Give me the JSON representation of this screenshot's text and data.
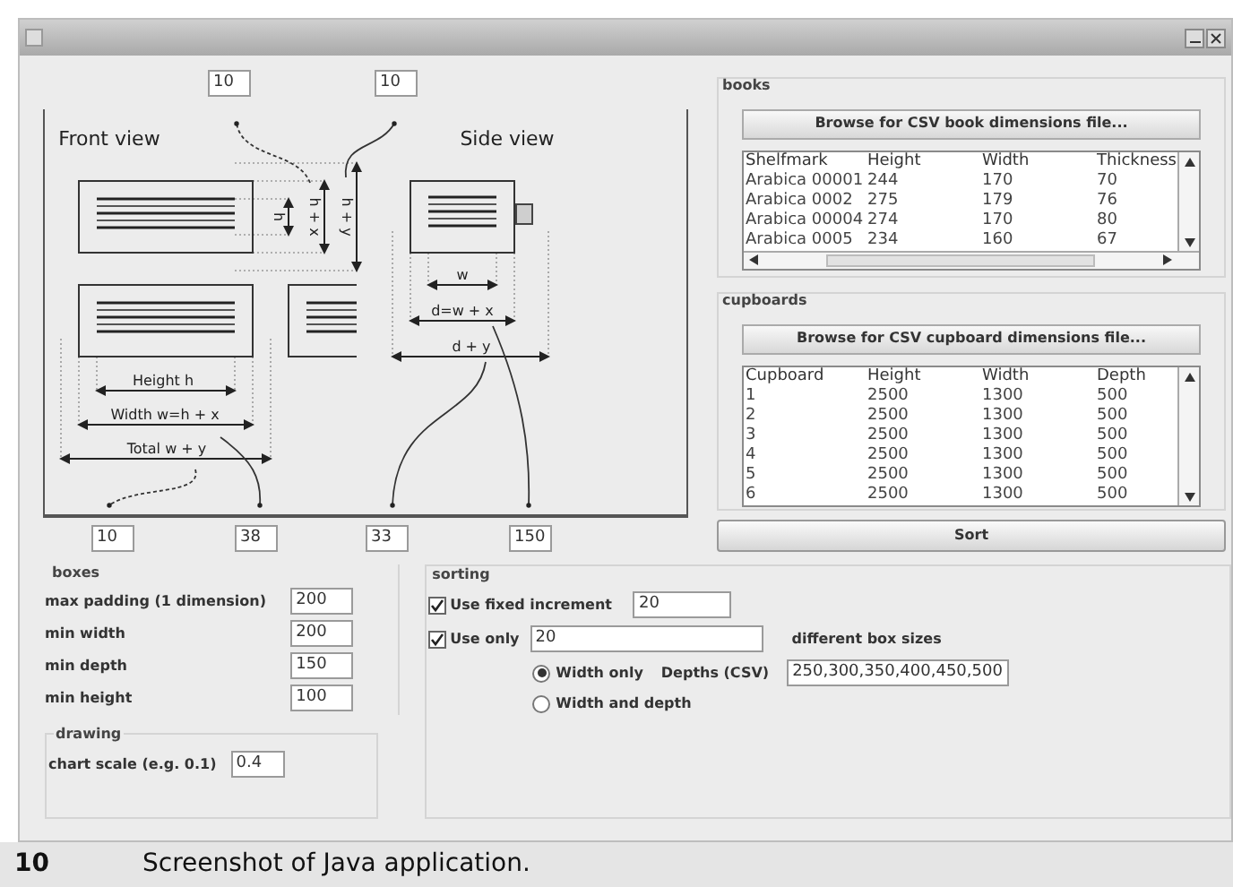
{
  "diagram": {
    "top_fields": [
      "10",
      "10"
    ],
    "labels": {
      "front_view": "Front view",
      "side_view": "Side view",
      "h": "h",
      "h_plus_x": "h + x",
      "h_plus_y": "h + y",
      "height": "Height h",
      "width": "Width w=h + x",
      "total": "Total w + y",
      "w": "w",
      "d": "d=w + x",
      "d_plus_y": "d + y"
    },
    "bottom_fields": [
      "10",
      "38",
      "33",
      "150"
    ]
  },
  "books": {
    "title": "books",
    "browse_button": "Browse for CSV book dimensions file...",
    "columns": [
      "Shelfmark",
      "Height",
      "Width",
      "Thickness"
    ],
    "rows": [
      [
        "Arabica 00001",
        "244",
        "170",
        "70"
      ],
      [
        "Arabica 0002",
        "275",
        "179",
        "76"
      ],
      [
        "Arabica 00004",
        "274",
        "170",
        "80"
      ],
      [
        "Arabica 0005",
        "234",
        "160",
        "67"
      ]
    ]
  },
  "cupboards": {
    "title": "cupboards",
    "browse_button": "Browse for CSV cupboard dimensions file...",
    "columns": [
      "Cupboard",
      "Height",
      "Width",
      "Depth"
    ],
    "rows": [
      [
        "1",
        "2500",
        "1300",
        "500"
      ],
      [
        "2",
        "2500",
        "1300",
        "500"
      ],
      [
        "3",
        "2500",
        "1300",
        "500"
      ],
      [
        "4",
        "2500",
        "1300",
        "500"
      ],
      [
        "5",
        "2500",
        "1300",
        "500"
      ],
      [
        "6",
        "2500",
        "1300",
        "500"
      ]
    ]
  },
  "sort_button": "Sort",
  "boxes": {
    "title": "boxes",
    "fields": [
      {
        "label": "max padding (1 dimension)",
        "value": "200"
      },
      {
        "label": "min width",
        "value": "200"
      },
      {
        "label": "min depth",
        "value": "150"
      },
      {
        "label": "min height",
        "value": "100"
      }
    ]
  },
  "drawing": {
    "title": "drawing",
    "fields": [
      {
        "label": "chart scale (e.g. 0.1)",
        "value": "0.4"
      }
    ]
  },
  "sorting": {
    "title": "sorting",
    "fixed_increment": {
      "label": "Use fixed increment",
      "checked": true,
      "value": "20"
    },
    "use_only": {
      "label": "Use only",
      "checked": true,
      "value": "20",
      "suffix": "different box sizes"
    },
    "radios": [
      {
        "label": "Width only",
        "selected": true
      },
      {
        "label": "Width and depth",
        "selected": false
      }
    ],
    "depths": {
      "label": "Depths (CSV)",
      "value": "250,300,350,400,450,500"
    }
  },
  "caption": {
    "number": "10",
    "text": "Screenshot of Java application."
  }
}
